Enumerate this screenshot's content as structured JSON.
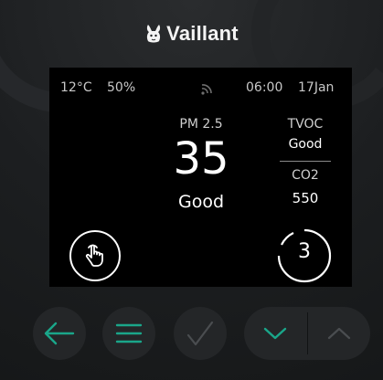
{
  "brand": {
    "name": "Vaillant",
    "logo_icon": "hare-logo-icon"
  },
  "status_bar": {
    "temperature": "12°C",
    "humidity": "50%",
    "wifi_icon": "wifi-icon",
    "time": "06:00",
    "date": "17Jan"
  },
  "pm25": {
    "label": "PM 2.5",
    "value": "35",
    "status": "Good"
  },
  "tvoc": {
    "label": "TVOC",
    "status": "Good"
  },
  "co2": {
    "label": "CO2",
    "value": "550"
  },
  "controls": {
    "hand_icon": "hand-pointer-icon",
    "timer_value": "3"
  },
  "hardware_buttons": {
    "back_icon": "arrow-left-icon",
    "menu_icon": "menu-icon",
    "ok_icon": "check-icon",
    "down_icon": "chevron-down-icon",
    "up_icon": "chevron-up-icon"
  },
  "colors": {
    "accent": "#1aa68a",
    "screen_bg": "#000000",
    "device_bg": "#1c1e20",
    "button_bg": "#242628",
    "inactive_icon": "#4a4d50"
  }
}
